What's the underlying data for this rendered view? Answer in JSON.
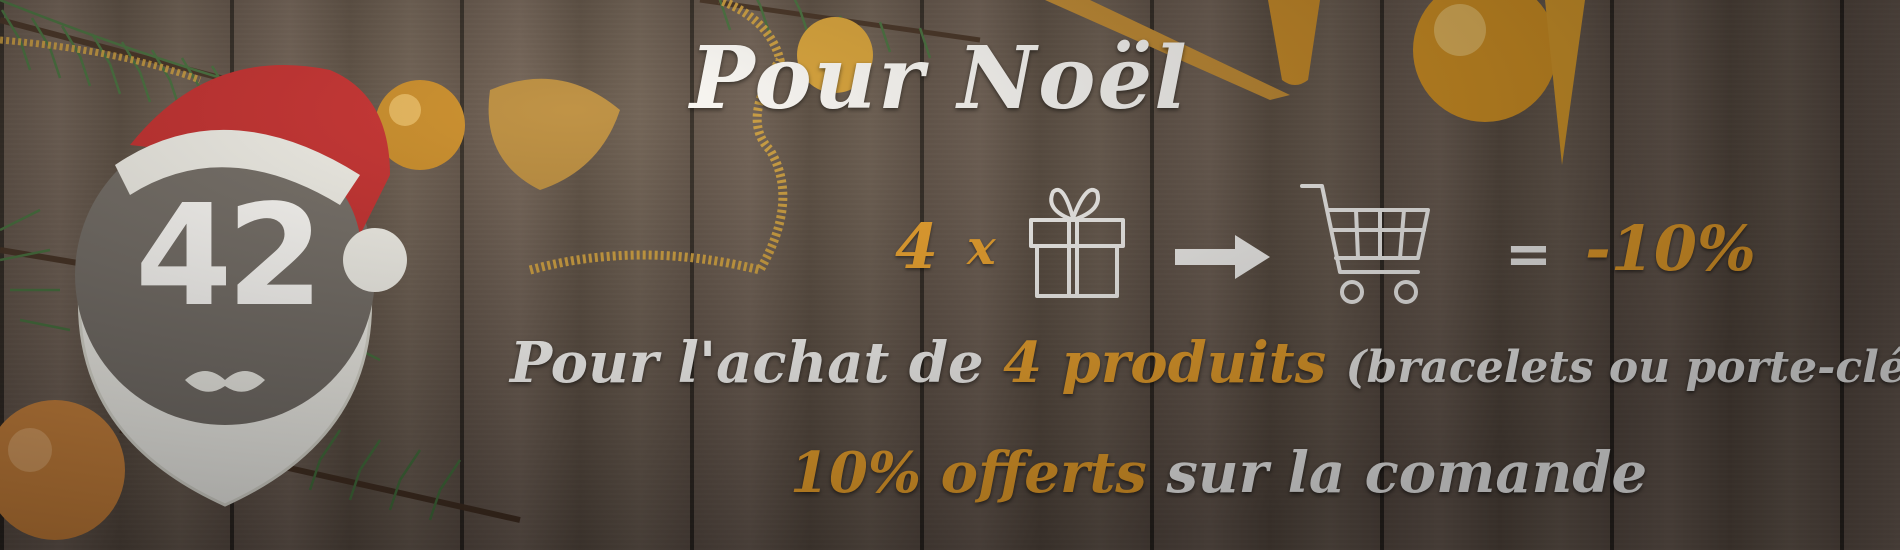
{
  "logo": {
    "number": "42",
    "icon": "santa-hat-badge-icon"
  },
  "headline": "Pour Noël",
  "promo": {
    "quantity": "4",
    "times": "x",
    "gift_icon": "gift-icon",
    "arrow_icon": "arrow-right-icon",
    "cart_icon": "shopping-cart-icon",
    "equals": "=",
    "discount": "-10%"
  },
  "line1": {
    "prefix": "Pour l'achat de",
    "highlight": "4 produits",
    "suffix": "(bracelets ou porte-clés),"
  },
  "line2": {
    "highlight": "10% offerts",
    "suffix": "sur la comande"
  },
  "colors": {
    "accent": "#f2a52a",
    "text": "#ffffff",
    "wood": "#5a4d45"
  }
}
